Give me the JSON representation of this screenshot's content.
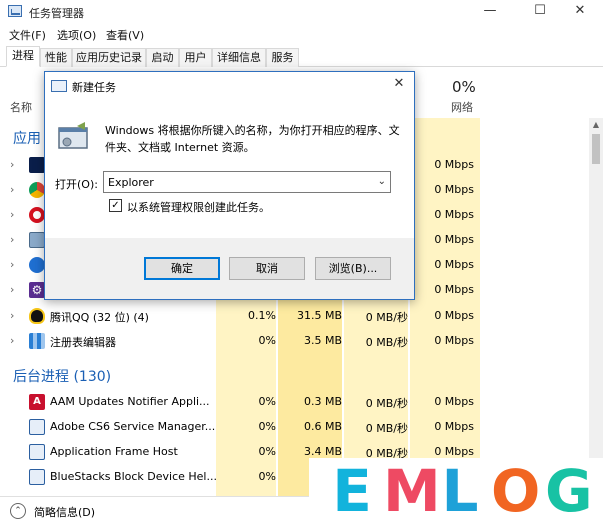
{
  "window": {
    "title": "任务管理器",
    "min": "—",
    "max": "☐",
    "close": "✕"
  },
  "menu": [
    "文件(F)",
    "选项(O)",
    "查看(V)"
  ],
  "tabs": [
    "进程",
    "性能",
    "应用历史记录",
    "启动",
    "用户",
    "详细信息",
    "服务"
  ],
  "columns": {
    "name": "名称",
    "net_pct": "0%",
    "net_label": "网络"
  },
  "sections": {
    "apps": "应用",
    "background": "后台进程 (130)"
  },
  "app_rows": [
    {
      "name": "",
      "cpu": "",
      "mem": "",
      "disk": "",
      "net": "0 Mbps",
      "icon": "photoshop-icon"
    },
    {
      "name": "",
      "cpu": "",
      "mem": "",
      "disk": "",
      "net": "0 Mbps",
      "icon": "chrome-icon"
    },
    {
      "name": "",
      "cpu": "",
      "mem": "",
      "disk": "",
      "net": "0 Mbps",
      "icon": "opera-icon"
    },
    {
      "name": "",
      "cpu": "",
      "mem": "",
      "disk": "",
      "net": "0 Mbps",
      "icon": "remote-icon"
    },
    {
      "name": "",
      "cpu": "",
      "mem": "",
      "disk": "",
      "net": "0 Mbps",
      "icon": "globe-icon"
    },
    {
      "name": "",
      "cpu": "",
      "mem": "",
      "disk": "",
      "net": "0 Mbps",
      "icon": "gear-icon"
    },
    {
      "name": "腾讯QQ (32 位) (4)",
      "cpu": "0.1%",
      "mem": "31.5 MB",
      "disk": "0 MB/秒",
      "net": "0 Mbps",
      "icon": "qq-icon"
    },
    {
      "name": "注册表编辑器",
      "cpu": "0%",
      "mem": "3.5 MB",
      "disk": "0 MB/秒",
      "net": "0 Mbps",
      "icon": "regedit-icon"
    }
  ],
  "bg_rows": [
    {
      "name": "AAM Updates Notifier Appli...",
      "cpu": "0%",
      "mem": "0.3 MB",
      "disk": "0 MB/秒",
      "net": "0 Mbps",
      "icon": "adobe-icon"
    },
    {
      "name": "Adobe CS6 Service Manager...",
      "cpu": "0%",
      "mem": "0.6 MB",
      "disk": "0 MB/秒",
      "net": "0 Mbps",
      "icon": "service-icon"
    },
    {
      "name": "Application Frame Host",
      "cpu": "0%",
      "mem": "3.4 MB",
      "disk": "0 MB/秒",
      "net": "0 Mbps",
      "icon": "app-frame-icon"
    },
    {
      "name": "BlueStacks Block Device Hel...",
      "cpu": "0%",
      "mem": "",
      "disk": "",
      "net": "",
      "icon": "bluestacks-icon"
    }
  ],
  "footer": {
    "label": "简略信息(D)"
  },
  "dialog": {
    "title": "新建任务",
    "close": "✕",
    "desc": "Windows 将根据你所键入的名称，为你打开相应的程序、文件夹、文档或 Internet 资源。",
    "open_label": "打开(O):",
    "open_value": "Explorer",
    "admin_label": "以系统管理权限创建此任务。",
    "admin_checked": true,
    "ok": "确定",
    "cancel": "取消",
    "browse": "浏览(B)..."
  },
  "watermark": {
    "letters": [
      "E",
      "M",
      "L",
      "O",
      "G"
    ],
    "colors": [
      "#12b3dc",
      "#ee4a63",
      "#1ea1d8",
      "#f16522",
      "#18c2a4"
    ]
  },
  "colors": {
    "heat_light": "#fff4c4",
    "heat_medium": "#fdeaa0",
    "accent": "#1a5fb4",
    "dialog_border": "#2e6fbe"
  }
}
